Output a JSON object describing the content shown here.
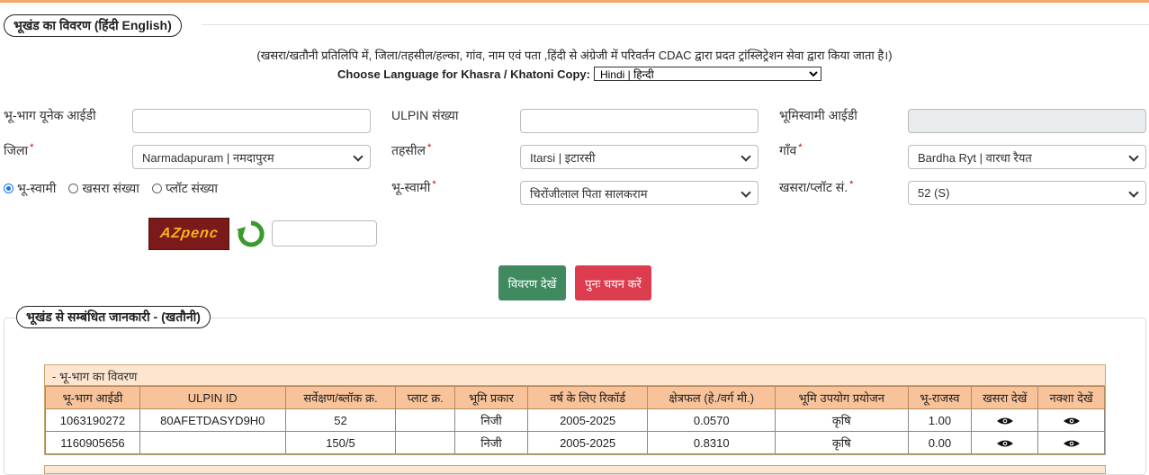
{
  "header": {
    "title": "भूखंड का विवरण  (हिंदी  English)"
  },
  "notice": "(खसरा/खतौनी प्रतिलिपि में, जिला/तहसील/हल्का, गांव, नाम एवं पता ,हिंदी से अंग्रेजी में परिवर्तन CDAC द्वारा प्रदत ट्रांस्लिट्रेशन सेवा द्वारा किया जाता है।)",
  "language": {
    "label": "Choose Language for Khasra / Khatoni Copy:",
    "selected": "Hindi | हिन्दी"
  },
  "form": {
    "unique_id_label": "भू-भाग यूनेक आईडी",
    "unique_id_value": "",
    "ulpin_label": "ULPIN संख्या",
    "ulpin_value": "",
    "owner_id_label": "भूमिस्वामी आईडी",
    "owner_id_value": "",
    "district_label": "जिला",
    "district_value": "Narmadapuram | नमदापुरम",
    "tehsil_label": "तहसील",
    "tehsil_value": "Itarsi | इटारसी",
    "village_label": "गाँव",
    "village_value": "Bardha Ryt | वारधा रैयत",
    "radio_options": [
      "भू-स्वामी",
      "खसरा संख्या",
      "प्लॉट संख्या"
    ],
    "radio_selected": 0,
    "owner_label": "भू-स्वामी",
    "owner_value": "चिरोंजीलाल पिता सालकराम",
    "khasra_label": "खसरा/प्लॉट सं.",
    "khasra_value": "52 (S)",
    "required_mark": "*"
  },
  "captcha": {
    "text": "AZpenc",
    "input_value": ""
  },
  "buttons": {
    "view": "विवरण देखें",
    "reset": "पुनः चयन करें"
  },
  "section": {
    "title": "भूखंड से सम्बंधित जानकारी -   (खतौनी)",
    "caption": "- भू-भाग का विवरण",
    "columns": [
      "भू-भाग आईडी",
      "ULPIN ID",
      "सर्वेक्षण/ब्लॉक क्र.",
      "प्लाट क्र.",
      "भूमि प्रकार",
      "वर्ष के लिए रिकॉर्ड",
      "क्षेत्रफल (हे./वर्ग मी.)",
      "भूमि उपयोग प्रयोजन",
      "भू-राजस्व",
      "खसरा देखें",
      "नक्शा देखें"
    ],
    "rows": [
      [
        "1063190272",
        "80AFETDASYD9H0",
        "52",
        "",
        "निजी",
        "2005-2025",
        "0.0570",
        "कृषि",
        "1.00"
      ],
      [
        "1160905656",
        "",
        "150/5",
        "",
        "निजी",
        "2005-2025",
        "0.8310",
        "कृषि",
        "0.00"
      ]
    ]
  },
  "colors": {
    "accent_green": "#3f8a5f",
    "accent_red": "#dd3b4e",
    "table_header": "#f8c39a",
    "table_caption": "#fde5cf"
  },
  "icons": {
    "refresh": "refresh-icon",
    "view": "eye-icon"
  }
}
